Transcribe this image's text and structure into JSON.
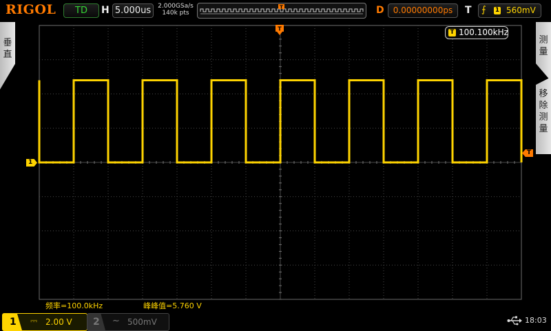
{
  "header": {
    "brand": "RIGOL",
    "run_state": "TD",
    "horizontal_label": "H",
    "time_base": "5.000us",
    "sample_rate": "2.000GSa/s",
    "memory_depth": "140k pts",
    "delay_label": "D",
    "delay_value": "0.00000000ps",
    "trigger_label": "T",
    "trigger_channel": "1",
    "trigger_level": "560mV"
  },
  "side_tabs": {
    "left": "垂直",
    "right_top": "测量",
    "right_bottom": "移除测量"
  },
  "freq_badge": {
    "icon": "T",
    "value": "100.100kHz"
  },
  "markers": {
    "ch1": "1",
    "trigger_level": "T"
  },
  "measurements": {
    "frequency": "频率=100.0kHz",
    "peak_to_peak": "峰峰值=5.760 V"
  },
  "channels": [
    {
      "number": "1",
      "coupling": "⎓",
      "scale": "2.00 V",
      "active": true,
      "color": "#ffd400"
    },
    {
      "number": "2",
      "coupling": "~",
      "scale": "500mV",
      "active": false,
      "color": "#777777"
    }
  ],
  "status": {
    "time": "18:03",
    "usb_icon": "usb-icon"
  },
  "waveform": {
    "channel": "1",
    "shape": "square",
    "color": "#ffd400",
    "frequency_hz": 100000,
    "high_divisions_above_center": 2.4,
    "low_divisions_above_center": 0,
    "time_per_division_us": 5
  }
}
